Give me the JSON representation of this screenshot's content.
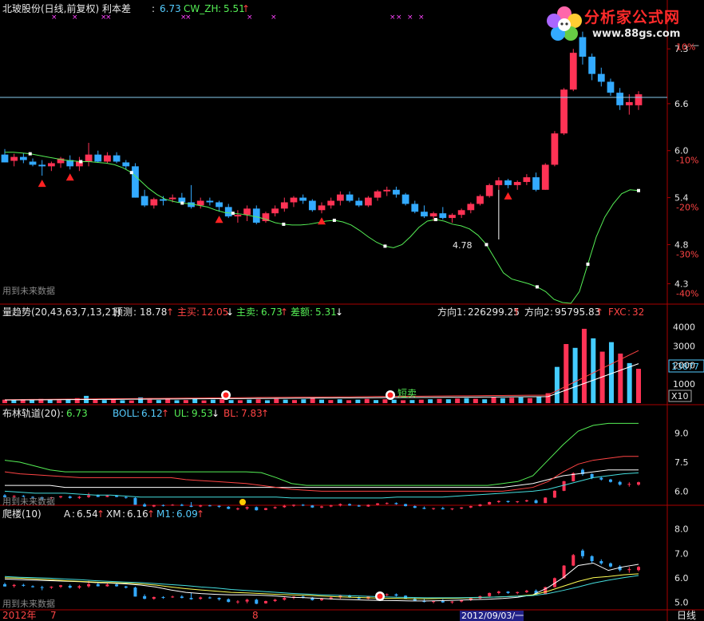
{
  "theme": {
    "bg": "#000000",
    "up": "#ff3355",
    "down": "#33aaff",
    "frame": "#aa0000",
    "ma_green": "#55ee55",
    "bull_red": "#ff4444",
    "white": "#ffffff",
    "cyan": "#44dddd",
    "yellow": "#ffff55",
    "magenta": "#ff44ff"
  },
  "watermark": {
    "text": "分析家公式网",
    "url": "www.88gs.com"
  },
  "footer": {
    "year_label": "2012年",
    "month_7": "7",
    "month_8": "8",
    "cursor_date": "2012/09/03/一",
    "period": "日线"
  },
  "chart_data": [
    {
      "type": "candlestick",
      "panel": "main",
      "title": "北玻股份(日线,前复权) 利本差",
      "indicators": [
        {
          "label": "",
          "value": "6.73"
        },
        {
          "label": "CW_ZH",
          "value": "5.51",
          "arrow": "↑"
        }
      ],
      "notice": "用到未来数据",
      "ylim": [
        4.05,
        7.7
      ],
      "y_ticks": [
        "7.3",
        "6.6",
        "6.0",
        "5.4",
        "4.8",
        "4.3"
      ],
      "pct_ticks": [
        "10%",
        "-10%",
        "-20%",
        "-30%",
        "-40%"
      ],
      "right_top_cut": "—",
      "reference_level": 6.68,
      "candles": [
        [
          5.95,
          6.02,
          5.85,
          5.85
        ],
        [
          5.87,
          5.96,
          5.8,
          5.92
        ],
        [
          5.92,
          5.97,
          5.84,
          5.88
        ],
        [
          5.86,
          5.9,
          5.8,
          5.82
        ],
        [
          5.82,
          5.88,
          5.68,
          5.8
        ],
        [
          5.8,
          5.86,
          5.74,
          5.84
        ],
        [
          5.84,
          5.92,
          5.78,
          5.9
        ],
        [
          5.88,
          5.94,
          5.76,
          5.8
        ],
        [
          5.8,
          5.92,
          5.74,
          5.86
        ],
        [
          5.86,
          6.1,
          5.8,
          5.95
        ],
        [
          5.95,
          6.0,
          5.85,
          5.86
        ],
        [
          5.86,
          5.98,
          5.84,
          5.94
        ],
        [
          5.94,
          5.98,
          5.84,
          5.86
        ],
        [
          5.85,
          5.88,
          5.76,
          5.8
        ],
        [
          5.8,
          5.84,
          5.4,
          5.4
        ],
        [
          5.42,
          5.5,
          5.28,
          5.3
        ],
        [
          5.3,
          5.4,
          5.26,
          5.38
        ],
        [
          5.38,
          5.42,
          5.3,
          5.36
        ],
        [
          5.38,
          5.44,
          5.34,
          5.4
        ],
        [
          5.4,
          5.46,
          5.32,
          5.34
        ],
        [
          5.34,
          5.56,
          5.26,
          5.28
        ],
        [
          5.3,
          5.4,
          5.26,
          5.36
        ],
        [
          5.36,
          5.4,
          5.3,
          5.34
        ],
        [
          5.34,
          5.36,
          5.22,
          5.28
        ],
        [
          5.28,
          5.32,
          5.14,
          5.16
        ],
        [
          5.16,
          5.24,
          5.08,
          5.18
        ],
        [
          5.18,
          5.3,
          5.1,
          5.26
        ],
        [
          5.26,
          5.3,
          5.06,
          5.08
        ],
        [
          5.1,
          5.22,
          5.08,
          5.2
        ],
        [
          5.2,
          5.3,
          5.16,
          5.26
        ],
        [
          5.26,
          5.4,
          5.22,
          5.34
        ],
        [
          5.34,
          5.42,
          5.28,
          5.4
        ],
        [
          5.4,
          5.44,
          5.32,
          5.36
        ],
        [
          5.36,
          5.38,
          5.22,
          5.24
        ],
        [
          5.24,
          5.34,
          5.2,
          5.3
        ],
        [
          5.3,
          5.4,
          5.26,
          5.36
        ],
        [
          5.36,
          5.48,
          5.3,
          5.44
        ],
        [
          5.44,
          5.48,
          5.34,
          5.36
        ],
        [
          5.36,
          5.4,
          5.28,
          5.3
        ],
        [
          5.3,
          5.42,
          5.28,
          5.4
        ],
        [
          5.4,
          5.5,
          5.36,
          5.48
        ],
        [
          5.48,
          5.54,
          5.42,
          5.5
        ],
        [
          5.5,
          5.54,
          5.4,
          5.44
        ],
        [
          5.44,
          5.46,
          5.3,
          5.32
        ],
        [
          5.32,
          5.36,
          5.2,
          5.22
        ],
        [
          5.22,
          5.3,
          5.14,
          5.16
        ],
        [
          5.16,
          5.22,
          5.1,
          5.2
        ],
        [
          5.2,
          5.28,
          5.12,
          5.14
        ],
        [
          5.14,
          5.2,
          5.08,
          5.18
        ],
        [
          5.18,
          5.26,
          5.14,
          5.24
        ],
        [
          5.24,
          5.34,
          5.2,
          5.32
        ],
        [
          5.32,
          5.44,
          5.3,
          5.42
        ],
        [
          5.42,
          5.58,
          5.4,
          5.56
        ],
        [
          5.56,
          5.66,
          5.5,
          5.62
        ],
        [
          5.62,
          5.64,
          5.52,
          5.56
        ],
        [
          5.56,
          5.62,
          5.5,
          5.6
        ],
        [
          5.6,
          5.7,
          5.56,
          5.66
        ],
        [
          5.66,
          5.72,
          5.48,
          5.5
        ],
        [
          5.5,
          5.84,
          5.5,
          5.82
        ],
        [
          5.82,
          6.25,
          5.8,
          6.22
        ],
        [
          6.22,
          6.8,
          6.2,
          6.78
        ],
        [
          6.78,
          7.3,
          6.76,
          7.25
        ],
        [
          7.45,
          7.52,
          7.1,
          7.2
        ],
        [
          7.2,
          7.24,
          6.9,
          6.98
        ],
        [
          6.98,
          7.06,
          6.82,
          6.88
        ],
        [
          6.88,
          6.92,
          6.7,
          6.74
        ],
        [
          6.74,
          6.8,
          6.52,
          6.58
        ],
        [
          6.58,
          6.72,
          6.46,
          6.62
        ],
        [
          6.58,
          6.76,
          6.52,
          6.72
        ]
      ],
      "ma_line": [
        5.98,
        5.98,
        5.97,
        5.96,
        5.94,
        5.92,
        5.9,
        5.88,
        5.87,
        5.86,
        5.86,
        5.85,
        5.84,
        5.82,
        5.78,
        5.72,
        5.62,
        5.52,
        5.44,
        5.38,
        5.35,
        5.33,
        5.32,
        5.3,
        5.28,
        5.24,
        5.21,
        5.2,
        5.19,
        5.17,
        5.15,
        5.12,
        5.08,
        5.06,
        5.05,
        5.05,
        5.06,
        5.08,
        5.1,
        5.11,
        5.09,
        5.05,
        4.98,
        4.9,
        4.83,
        4.78,
        4.76,
        4.8,
        4.9,
        5.02,
        5.1,
        5.12,
        5.1,
        5.06,
        5.04,
        5.0,
        4.92,
        4.8,
        4.62,
        4.44,
        4.36,
        4.33,
        4.3,
        4.26,
        4.2,
        4.1,
        4.06,
        4.05,
        4.2,
        4.55,
        4.9,
        5.15,
        5.32,
        5.45,
        5.5,
        5.49
      ],
      "signal_marks": [
        {
          "i": 4,
          "kind": "triangle"
        },
        {
          "i": 7,
          "kind": "triangle"
        },
        {
          "i": 23,
          "kind": "triangle"
        },
        {
          "i": 34,
          "kind": "triangle"
        },
        {
          "i": 54,
          "kind": "triangle"
        }
      ],
      "annotation": {
        "text": "4.78",
        "i": 53
      }
    },
    {
      "type": "bar",
      "panel": "volume",
      "title": "量趋势(20,43,63,7,13,21)",
      "indicators": [
        {
          "label": "预测",
          "value": "18.78",
          "arrow": "↑"
        },
        {
          "label": "主买",
          "value": "12.05",
          "arrow": "↓"
        },
        {
          "label": "主卖",
          "value": "6.73",
          "arrow": "↑"
        },
        {
          "label": "差额",
          "value": "5.31",
          "arrow": "↓"
        },
        {
          "label": "方向1",
          "value": "226299.25",
          "arrow": "↑"
        },
        {
          "label": "方向2",
          "value": "95795.83",
          "arrow": "↑"
        },
        {
          "label": "FXC",
          "value": "32"
        }
      ],
      "y_ticks": [
        "4000",
        "3000",
        "2000",
        "1000"
      ],
      "ylim": [
        0,
        4400
      ],
      "badge": "13877",
      "scale_label": "X10",
      "signal_label": "短卖",
      "values": [
        180,
        150,
        200,
        160,
        220,
        180,
        150,
        200,
        260,
        380,
        180,
        160,
        220,
        150,
        140,
        300,
        180,
        160,
        200,
        150,
        160,
        220,
        140,
        180,
        200,
        160,
        150,
        180,
        200,
        150,
        220,
        180,
        160,
        200,
        250,
        180,
        160,
        200,
        150,
        180,
        220,
        160,
        200,
        180,
        150,
        160,
        180,
        200,
        220,
        200,
        240,
        260,
        230,
        200,
        300,
        260,
        280,
        300,
        260,
        350,
        520,
        1900,
        3100,
        2900,
        3900,
        3400,
        2700,
        3200,
        2600,
        2100,
        1800
      ]
    },
    {
      "type": "line",
      "panel": "boll",
      "title": "布林轨道(20)",
      "indicators": [
        {
          "label": "",
          "value": "6.73"
        },
        {
          "label": "BOLL",
          "value": "6.12",
          "arrow": "↑"
        },
        {
          "label": "UL",
          "value": "9.53",
          "arrow": "↓"
        },
        {
          "label": "BL",
          "value": "7.83",
          "arrow": "↑"
        }
      ],
      "notice": "用到未来数据",
      "y_ticks": [
        "9.0",
        "7.5",
        "6.0"
      ],
      "ylim": [
        5.4,
        9.6
      ],
      "series": [
        {
          "name": "UL",
          "values": [
            7.6,
            7.5,
            7.3,
            7.1,
            7.0,
            7.0,
            7.0,
            7.0,
            7.0,
            7.0,
            7.0,
            7.0,
            7.0,
            7.0,
            7.0,
            7.0,
            7.0,
            6.96,
            6.7,
            6.4,
            6.3,
            6.3,
            6.3,
            6.3,
            6.3,
            6.3,
            6.3,
            6.3,
            6.3,
            6.3,
            6.3,
            6.3,
            6.3,
            6.4,
            6.5,
            6.8,
            7.6,
            8.4,
            9.1,
            9.4,
            9.5,
            9.5,
            9.5
          ]
        },
        {
          "name": "BOLL",
          "values": [
            6.3,
            6.3,
            6.3,
            6.3,
            6.2,
            6.2,
            6.2,
            6.2,
            6.2,
            6.2,
            6.2,
            6.2,
            6.2,
            6.2,
            6.2,
            6.2,
            6.2,
            6.2,
            6.2,
            6.2,
            6.2,
            6.2,
            6.2,
            6.2,
            6.2,
            6.2,
            6.2,
            6.2,
            6.2,
            6.2,
            6.2,
            6.2,
            6.2,
            6.2,
            6.3,
            6.4,
            6.6,
            6.8,
            6.9,
            7.0,
            7.1,
            7.1,
            7.1
          ]
        },
        {
          "name": "BL",
          "values": [
            7.0,
            6.9,
            6.85,
            6.8,
            6.75,
            6.7,
            6.7,
            6.7,
            6.7,
            6.7,
            6.7,
            6.7,
            6.6,
            6.55,
            6.5,
            6.45,
            6.4,
            6.3,
            6.2,
            6.1,
            6.05,
            6.0,
            6.0,
            6.0,
            6.0,
            6.0,
            6.0,
            6.0,
            6.0,
            6.0,
            6.0,
            6.0,
            6.0,
            6.0,
            6.1,
            6.2,
            6.5,
            7.0,
            7.4,
            7.6,
            7.7,
            7.8,
            7.8
          ]
        },
        {
          "name": "LB",
          "values": [
            6.0,
            5.95,
            5.9,
            5.9,
            5.9,
            5.85,
            5.8,
            5.8,
            5.75,
            5.7,
            5.7,
            5.7,
            5.7,
            5.7,
            5.7,
            5.7,
            5.7,
            5.7,
            5.7,
            5.65,
            5.65,
            5.65,
            5.65,
            5.65,
            5.65,
            5.65,
            5.7,
            5.7,
            5.7,
            5.7,
            5.75,
            5.8,
            5.85,
            5.9,
            5.95,
            6.0,
            6.1,
            6.3,
            6.5,
            6.7,
            6.8,
            6.9,
            6.95
          ]
        }
      ]
    },
    {
      "type": "line",
      "panel": "pa_lou",
      "title": "爬楼(10)",
      "indicators": [
        {
          "label": "A",
          "value": "6.54",
          "arrow": "↑"
        },
        {
          "label": "XM",
          "value": "6.16",
          "arrow": "↑"
        },
        {
          "label": "M1",
          "value": "6.09",
          "arrow": "↑"
        }
      ],
      "notice": "用到未来数据",
      "y_ticks": [
        "8.0",
        "7.0",
        "6.0",
        "5.0"
      ],
      "ylim": [
        4.75,
        8.35
      ],
      "series": [
        {
          "name": "A",
          "values": [
            5.95,
            5.92,
            5.9,
            5.88,
            5.86,
            5.84,
            5.8,
            5.78,
            5.75,
            5.7,
            5.62,
            5.5,
            5.4,
            5.35,
            5.32,
            5.3,
            5.3,
            5.28,
            5.25,
            5.2,
            5.18,
            5.15,
            5.12,
            5.1,
            5.08,
            5.07,
            5.06,
            5.05,
            5.05,
            5.06,
            5.08,
            5.1,
            5.12,
            5.15,
            5.2,
            5.3,
            5.6,
            6.0,
            6.5,
            6.6,
            6.3,
            6.45,
            6.55
          ]
        },
        {
          "name": "XM",
          "values": [
            6.0,
            5.98,
            5.95,
            5.92,
            5.88,
            5.85,
            5.82,
            5.8,
            5.78,
            5.75,
            5.7,
            5.62,
            5.55,
            5.5,
            5.45,
            5.4,
            5.38,
            5.35,
            5.32,
            5.3,
            5.28,
            5.25,
            5.22,
            5.2,
            5.18,
            5.16,
            5.15,
            5.14,
            5.14,
            5.15,
            5.16,
            5.18,
            5.2,
            5.22,
            5.25,
            5.3,
            5.45,
            5.65,
            5.85,
            6.0,
            6.05,
            6.12,
            6.16
          ]
        },
        {
          "name": "M1",
          "values": [
            6.05,
            6.02,
            6.0,
            5.98,
            5.95,
            5.92,
            5.88,
            5.85,
            5.82,
            5.8,
            5.76,
            5.72,
            5.68,
            5.62,
            5.58,
            5.52,
            5.48,
            5.44,
            5.4,
            5.36,
            5.33,
            5.3,
            5.28,
            5.26,
            5.24,
            5.22,
            5.2,
            5.19,
            5.18,
            5.18,
            5.18,
            5.19,
            5.2,
            5.22,
            5.24,
            5.27,
            5.35,
            5.48,
            5.62,
            5.78,
            5.9,
            6.0,
            6.09
          ]
        }
      ]
    }
  ]
}
